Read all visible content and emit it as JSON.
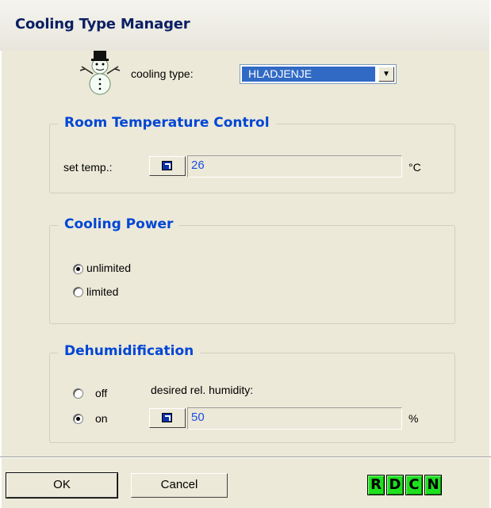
{
  "window": {
    "title": "Cooling Type Manager"
  },
  "cooling_type": {
    "label": "cooling type:",
    "selected": "HLADJENJE",
    "icon": "snowman-icon"
  },
  "room_temp": {
    "title": "Room Temperature Control",
    "set_label": "set temp.:",
    "value": "26",
    "unit": "°C"
  },
  "cooling_power": {
    "title": "Cooling Power",
    "options": [
      {
        "label": "unlimited",
        "checked": true
      },
      {
        "label": "limited",
        "checked": false
      }
    ]
  },
  "dehumidification": {
    "title": "Dehumidification",
    "off_label": "off",
    "on_label": "on",
    "selected": "on",
    "humidity_label": "desired rel. humidity:",
    "value": "50",
    "unit": "%"
  },
  "footer": {
    "ok_label": "OK",
    "cancel_label": "Cancel",
    "letter_buttons": [
      "R",
      "D",
      "C",
      "N"
    ]
  },
  "colors": {
    "accent_blue": "#0046d5",
    "selection": "#316ac5",
    "green_button": "#1fe01f"
  }
}
